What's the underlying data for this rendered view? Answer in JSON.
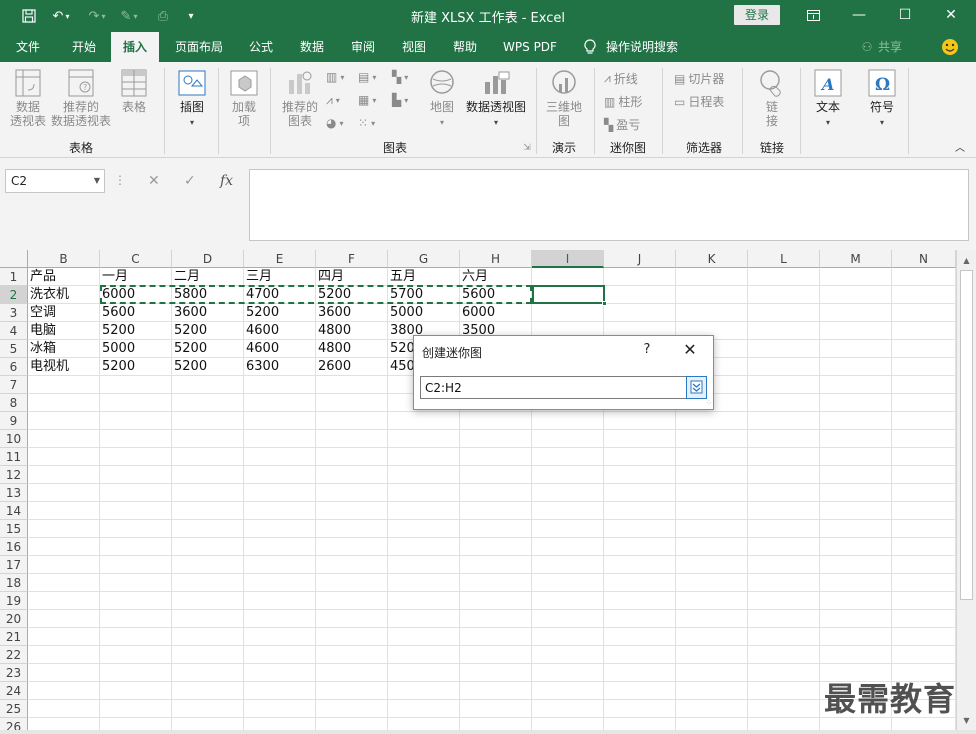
{
  "window": {
    "title": "新建 XLSX 工作表 - Excel",
    "login_label": "登录"
  },
  "ribbon_tabs": [
    {
      "label": "文件"
    },
    {
      "label": "开始"
    },
    {
      "label": "插入"
    },
    {
      "label": "页面布局"
    },
    {
      "label": "公式"
    },
    {
      "label": "数据"
    },
    {
      "label": "审阅"
    },
    {
      "label": "视图"
    },
    {
      "label": "帮助"
    },
    {
      "label": "WPS PDF"
    },
    {
      "label": "操作说明搜索"
    }
  ],
  "share_label": "共享",
  "ribbon": {
    "pivot_table": "数据\n透视表",
    "recommended_pivot": "推荐的\n数据透视表",
    "table": "表格",
    "illustrations": "插图",
    "addins": "加载\n项",
    "recommended_charts": "推荐的\n图表",
    "maps": "地图",
    "pivot_chart": "数据透视图",
    "map_3d": "三维地\n图",
    "spark_line": "折线",
    "spark_column": "柱形",
    "spark_winloss": "盈亏",
    "slicer": "切片器",
    "timeline": "日程表",
    "link": "链\n接",
    "text": "文本",
    "symbol": "符号",
    "groups": {
      "tables": "表格",
      "charts": "图表",
      "tours": "演示",
      "sparklines": "迷你图",
      "filters": "筛选器",
      "links": "链接"
    }
  },
  "formula_bar": {
    "name_box": "C2",
    "fx": "fx",
    "content": ""
  },
  "columns": [
    "B",
    "C",
    "D",
    "E",
    "F",
    "G",
    "H",
    "I",
    "J",
    "K",
    "L",
    "M",
    "N"
  ],
  "rows": [
    "1",
    "2",
    "3",
    "4",
    "5",
    "6",
    "7",
    "8",
    "9",
    "10",
    "11",
    "12",
    "13",
    "14",
    "15",
    "16",
    "17",
    "18",
    "19",
    "20",
    "21",
    "22",
    "23",
    "24",
    "25",
    "26"
  ],
  "table": {
    "header": [
      "产品",
      "一月",
      "二月",
      "三月",
      "四月",
      "五月",
      "六月"
    ],
    "rows": [
      [
        "洗衣机",
        "6000",
        "5800",
        "4700",
        "5200",
        "5700",
        "5600"
      ],
      [
        "空调",
        "5600",
        "3600",
        "5200",
        "3600",
        "5000",
        "6000"
      ],
      [
        "电脑",
        "5200",
        "5200",
        "4600",
        "4800",
        "3800",
        "3500"
      ],
      [
        "冰箱",
        "5000",
        "5200",
        "4600",
        "4800",
        "520",
        ""
      ],
      [
        "电视机",
        "5200",
        "5200",
        "6300",
        "2600",
        "450",
        ""
      ]
    ]
  },
  "dialog": {
    "title": "创建迷你图",
    "help": "?",
    "close": "✕",
    "range_value": "C2:H2"
  },
  "watermark": "最需教育",
  "colors": {
    "accent": "#217346",
    "ribbon_bg": "#f3f3f3"
  }
}
